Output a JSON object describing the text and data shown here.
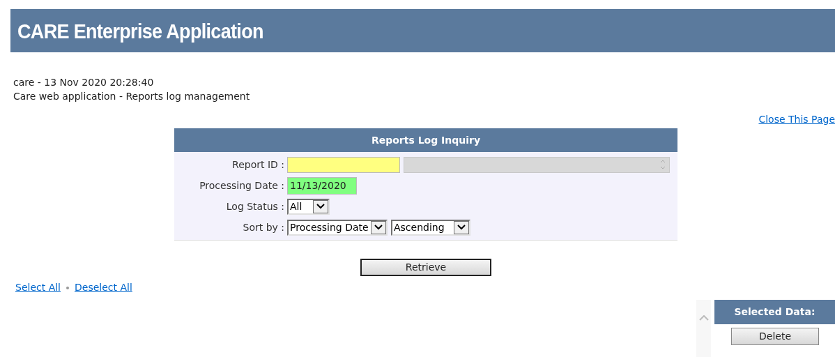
{
  "header": {
    "title": "CARE Enterprise Application"
  },
  "info": {
    "session": "care - 13 Nov 2020 20:28:40",
    "description": "Care web application - Reports log management"
  },
  "close_link": "Close This Page",
  "inquiry": {
    "title": "Reports Log Inquiry",
    "fields": [
      {
        "kind": "report",
        "label": "Report ID :",
        "color": "#ffff80"
      },
      {
        "kind": "text",
        "label": "Processing Date :",
        "value": "11/13/2020",
        "color": "#80ff80"
      },
      {
        "kind": "select",
        "label": "Log Status :",
        "selects": [
          "All"
        ]
      },
      {
        "kind": "select",
        "label": "Sort by :",
        "selects": [
          "Processing Date",
          "Ascending"
        ]
      }
    ]
  },
  "retrieve_button": "Retrieve",
  "selection_links": [
    "Select All",
    "Deselect All"
  ],
  "selected_panel": {
    "title": "Selected Data:",
    "button": "Delete"
  }
}
